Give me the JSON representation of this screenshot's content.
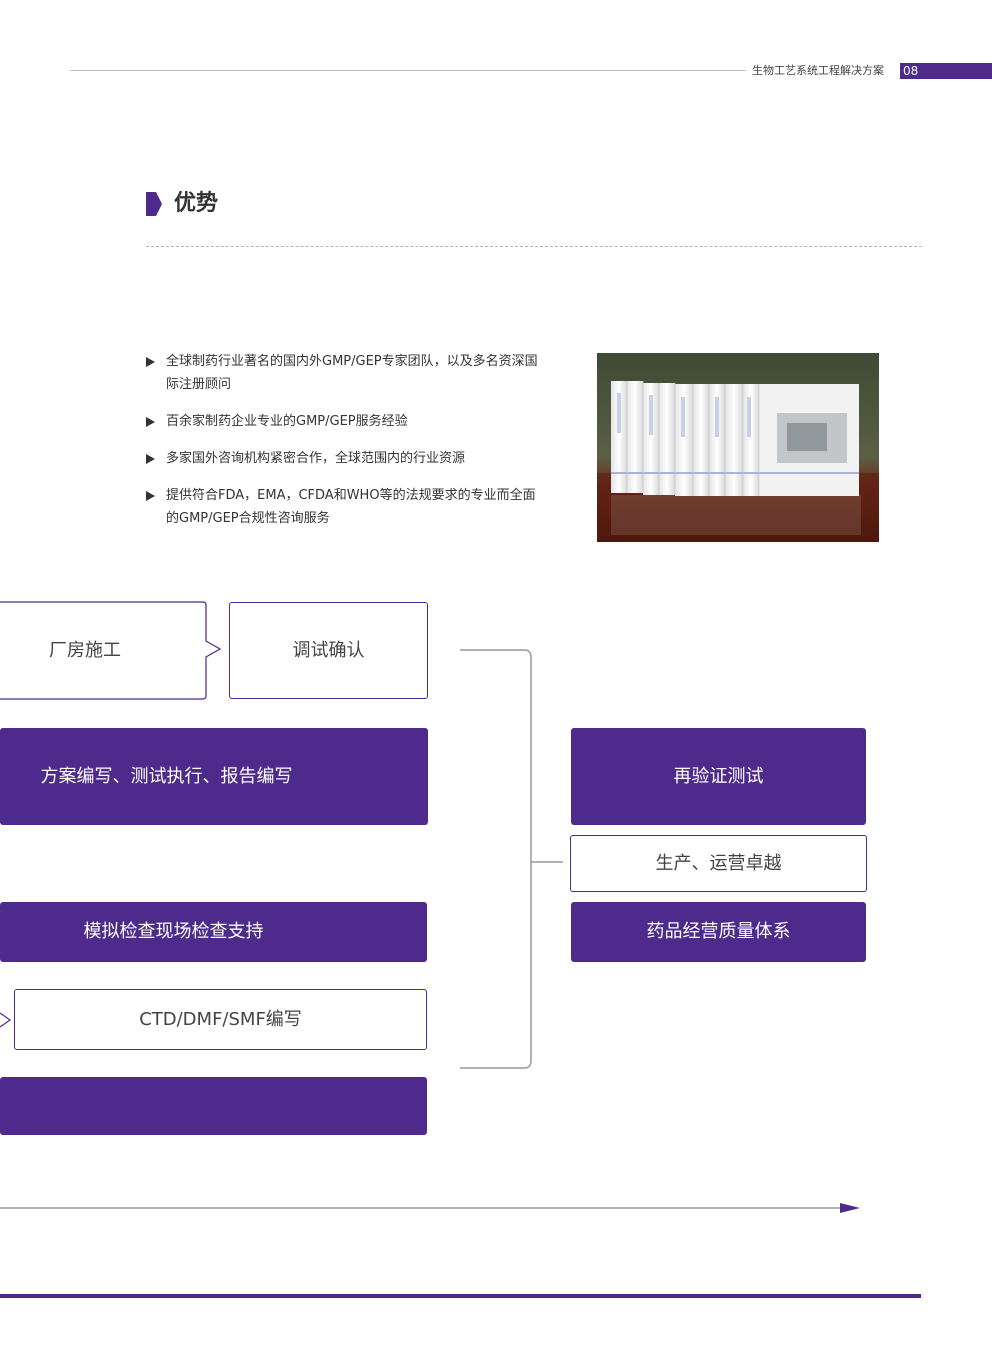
{
  "header": {
    "title": "生物工艺系统工程解决方案",
    "page_number": "08"
  },
  "section": {
    "title": "优势"
  },
  "bullets": [
    "全球制药行业著名的国内外GMP/GEP专家团队，以及多名资深国际注册顾问",
    "百余家制药企业专业的GMP/GEP服务经验",
    "多家国外咨询机构紧密合作，全球范围内的行业资源",
    "提供符合FDA，EMA，CFDA和WHO等的法规要求的专业而全面的GMP/GEP合规性咨询服务"
  ],
  "flow": {
    "plant_construction": "厂房施工",
    "commissioning": "调试确认",
    "protocol_writing": "方案编写、测试执行、报告编写",
    "mock_inspection": "模拟检查现场检查支持",
    "ctd_writing": "CTD/DMF/SMF编写",
    "bottom_bar": "",
    "revalidation": "再验证测试",
    "production_excellence": "生产、运营卓越",
    "quality_system": "药品经营质量体系"
  },
  "colors": {
    "accent": "#4e2a8c",
    "text": "#333333",
    "line": "#9a9a9a"
  }
}
